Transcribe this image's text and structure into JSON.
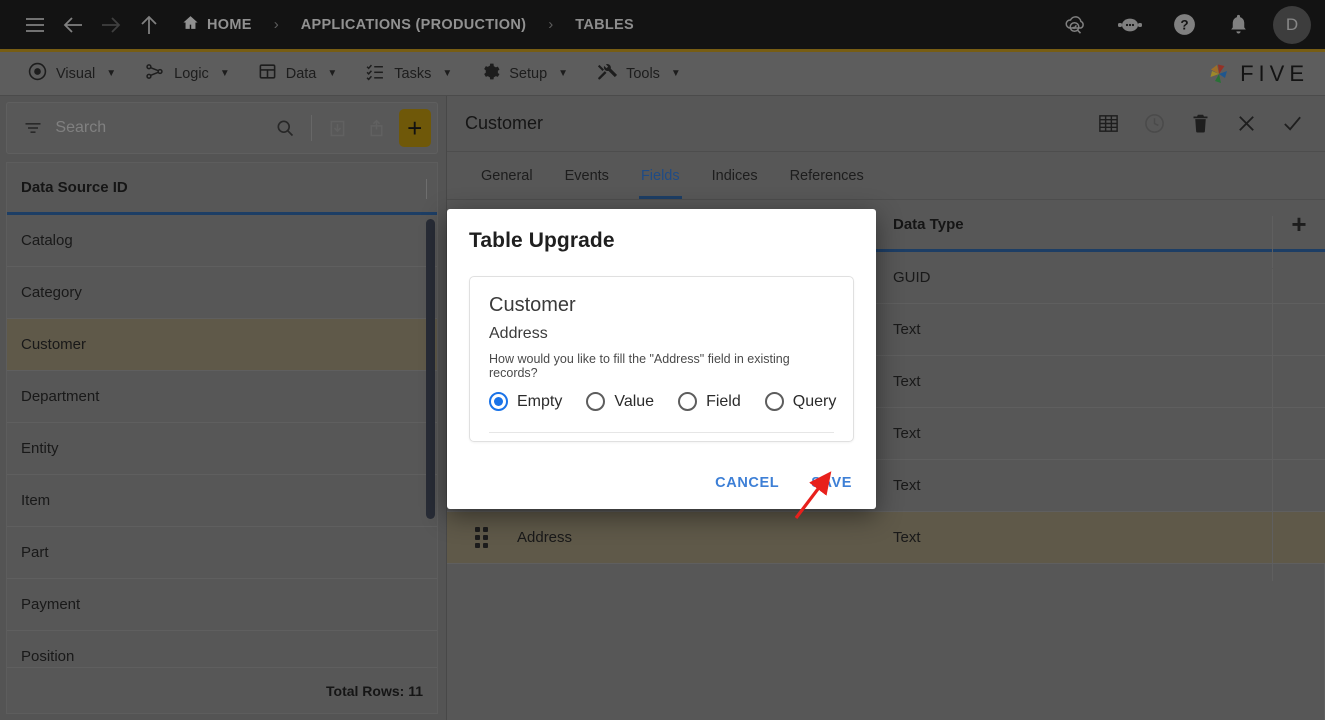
{
  "topbar": {
    "menu_icon": "hamburger-icon",
    "back_icon": "arrow-left-icon",
    "forward_icon": "arrow-right-icon",
    "up_icon": "arrow-up-icon",
    "home_icon": "home-icon",
    "breadcrumbs": [
      {
        "label": "HOME"
      },
      {
        "label": "APPLICATIONS (PRODUCTION)"
      },
      {
        "label": "TABLES"
      }
    ],
    "separator": "›",
    "actions": [
      {
        "name": "cloud-check-icon"
      },
      {
        "name": "chat-bot-icon"
      },
      {
        "name": "help-icon"
      },
      {
        "name": "bell-icon"
      }
    ],
    "avatar_initial": "D"
  },
  "menubar": {
    "items": [
      {
        "label": "Visual",
        "icon": "eye-icon"
      },
      {
        "label": "Logic",
        "icon": "nodes-icon"
      },
      {
        "label": "Data",
        "icon": "table-icon"
      },
      {
        "label": "Tasks",
        "icon": "checklist-icon"
      },
      {
        "label": "Setup",
        "icon": "gear-icon"
      },
      {
        "label": "Tools",
        "icon": "tools-icon"
      }
    ],
    "caret": "▼",
    "brand": "FIVE"
  },
  "sidebar": {
    "search": {
      "placeholder": "Search",
      "value": ""
    },
    "filter_icon": "filter-icon",
    "search_icon": "search-icon",
    "import_icon": "import-icon",
    "export_icon": "export-icon",
    "add_label": "+",
    "column_header": "Data Source ID",
    "rows": [
      {
        "label": "Catalog",
        "selected": false
      },
      {
        "label": "Category",
        "selected": false
      },
      {
        "label": "Customer",
        "selected": true
      },
      {
        "label": "Department",
        "selected": false
      },
      {
        "label": "Entity",
        "selected": false
      },
      {
        "label": "Item",
        "selected": false
      },
      {
        "label": "Part",
        "selected": false
      },
      {
        "label": "Payment",
        "selected": false
      },
      {
        "label": "Position",
        "selected": false
      }
    ],
    "footer": "Total Rows: 11"
  },
  "record": {
    "title": "Customer",
    "actions": [
      {
        "name": "grid-view-icon"
      },
      {
        "name": "history-clock-icon"
      },
      {
        "name": "delete-trash-icon"
      },
      {
        "name": "close-x-icon"
      },
      {
        "name": "confirm-check-icon"
      }
    ],
    "tabs": [
      {
        "label": "General",
        "active": false
      },
      {
        "label": "Events",
        "active": false
      },
      {
        "label": "Fields",
        "active": true
      },
      {
        "label": "Indices",
        "active": false
      },
      {
        "label": "References",
        "active": false
      }
    ],
    "fields_table": {
      "columns": [
        "",
        "",
        "Data Type",
        "+"
      ],
      "rows": [
        {
          "name": "",
          "type": "GUID",
          "selected": false
        },
        {
          "name": "",
          "type": "Text",
          "selected": false
        },
        {
          "name": "",
          "type": "Text",
          "selected": false
        },
        {
          "name": "",
          "type": "Text",
          "selected": false
        },
        {
          "name": "",
          "type": "Text",
          "selected": false
        },
        {
          "name": "Address",
          "type": "Text",
          "selected": true
        }
      ]
    }
  },
  "modal": {
    "title": "Table Upgrade",
    "table_name": "Customer",
    "field_name": "Address",
    "question": "How would you like to fill the \"Address\" field in existing records?",
    "options": [
      {
        "label": "Empty",
        "selected": true
      },
      {
        "label": "Value",
        "selected": false
      },
      {
        "label": "Field",
        "selected": false
      },
      {
        "label": "Query",
        "selected": false
      }
    ],
    "cancel_label": "CANCEL",
    "save_label": "SAVE"
  },
  "annotation": {
    "arrow_color": "#e8201c",
    "points_to": "SAVE"
  },
  "colors": {
    "accent_gold": "#a4820e",
    "accent_blue": "#2c5c96",
    "link_blue": "#3d7fd6",
    "radio_blue": "#1a73e8",
    "selected_row": "#8c836c",
    "topbar_bg": "#1c1c1c"
  }
}
